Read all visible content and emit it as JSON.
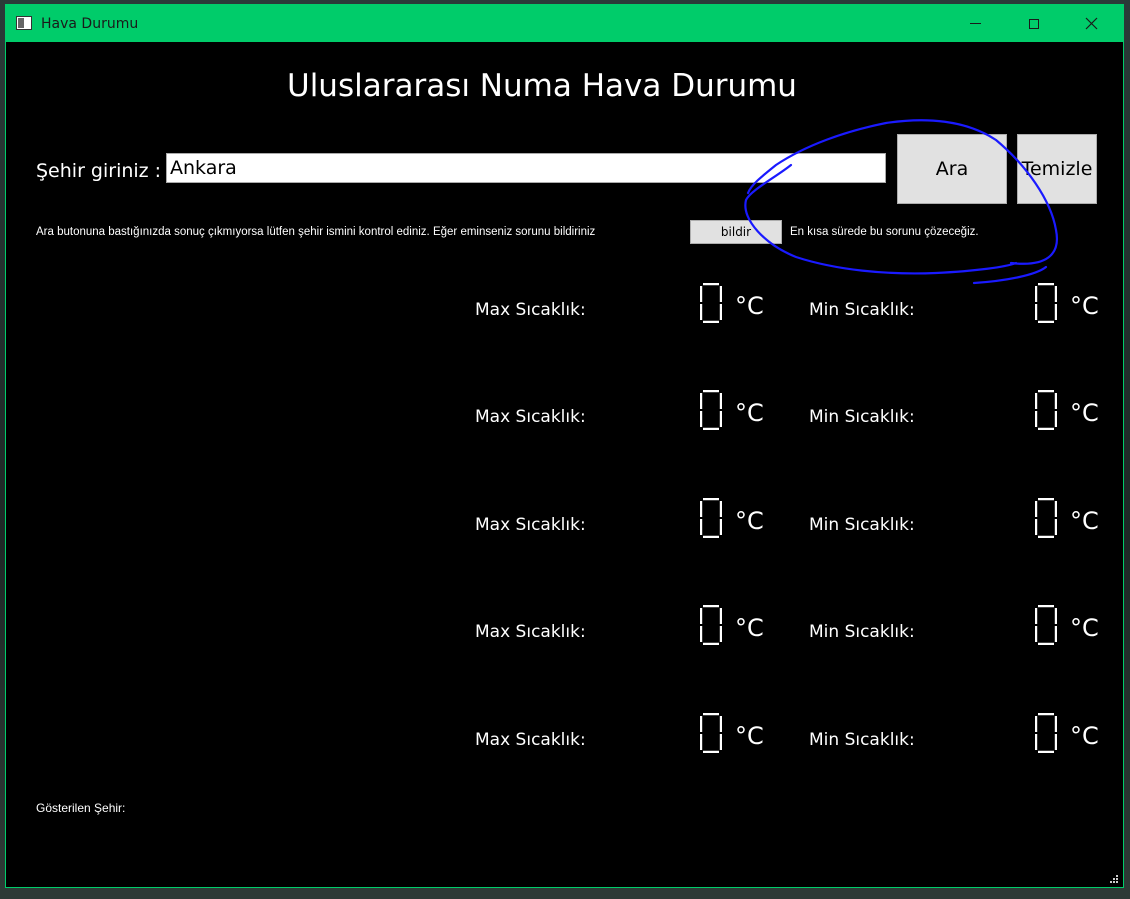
{
  "window": {
    "title": "Hava Durumu",
    "accent_color": "#00cc6a"
  },
  "main": {
    "heading": "Uluslararası Numa Hava Durumu",
    "city_label": "Şehir giriniz :",
    "city_value": "Ankara",
    "search_button": "Ara",
    "clear_button": "Temizle",
    "info_text": "Ara butonuna bastığınızda sonuç çıkmıyorsa lütfen şehir ismini kontrol ediniz. Eğer eminseniz sorunu bildiriniz",
    "report_button": "bildir",
    "info_text_after": "En kısa sürede bu sorunu çözeceğiz.",
    "shown_city_label": "Gösterilen Şehir:"
  },
  "forecast": [
    {
      "max_label": "Max Sıcaklık:",
      "max_value": "0",
      "max_unit": "°C",
      "min_label": "Min Sıcaklık:",
      "min_value": "0",
      "min_unit": "°C"
    },
    {
      "max_label": "Max Sıcaklık:",
      "max_value": "0",
      "max_unit": "°C",
      "min_label": "Min Sıcaklık:",
      "min_value": "0",
      "min_unit": "°C"
    },
    {
      "max_label": "Max Sıcaklık:",
      "max_value": "0",
      "max_unit": "°C",
      "min_label": "Min Sıcaklık:",
      "min_value": "0",
      "min_unit": "°C"
    },
    {
      "max_label": "Max Sıcaklık:",
      "max_value": "0",
      "max_unit": "°C",
      "min_label": "Min Sıcaklık:",
      "min_value": "0",
      "min_unit": "°C"
    },
    {
      "max_label": "Max Sıcaklık:",
      "max_value": "0",
      "max_unit": "°C",
      "min_label": "Min Sıcaklık:",
      "min_value": "0",
      "min_unit": "°C"
    }
  ],
  "annotation": {
    "color": "#1a1aff"
  }
}
